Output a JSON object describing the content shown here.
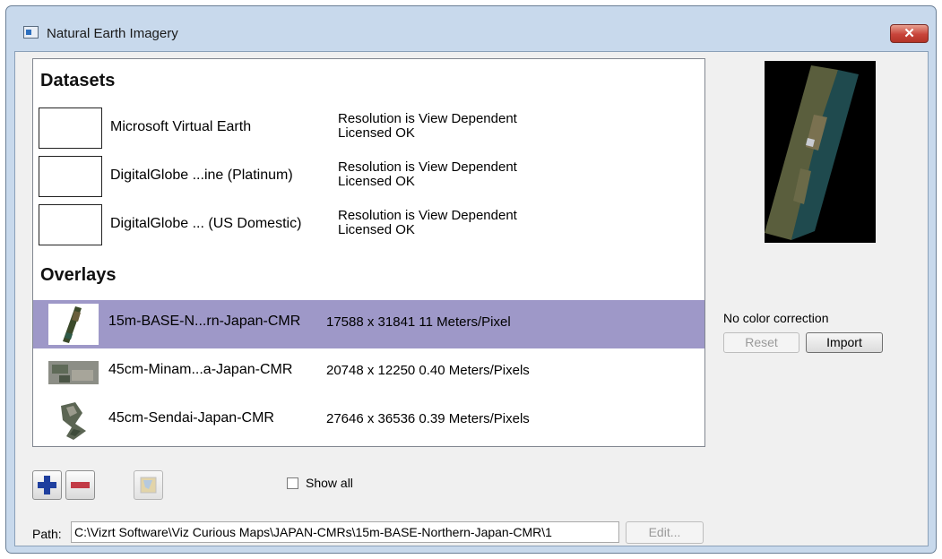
{
  "window": {
    "title": "Natural Earth Imagery",
    "close_label": "✕"
  },
  "datasets": {
    "heading": "Datasets",
    "items": [
      {
        "name": "Microsoft Virtual Earth",
        "info1": "Resolution is View Dependent",
        "info2": "Licensed OK"
      },
      {
        "name": "DigitalGlobe ...ine (Platinum)",
        "info1": "Resolution is View Dependent",
        "info2": "Licensed OK"
      },
      {
        "name": "DigitalGlobe ... (US Domestic)",
        "info1": "Resolution is View Dependent",
        "info2": "Licensed OK"
      }
    ]
  },
  "overlays": {
    "heading": "Overlays",
    "items": [
      {
        "name": "15m-BASE-N...rn-Japan-CMR",
        "info": "17588 x 31841 11 Meters/Pixel",
        "selected": true
      },
      {
        "name": "45cm-Minam...a-Japan-CMR",
        "info": "20748 x 12250  0.40 Meters/Pixels",
        "selected": false
      },
      {
        "name": "45cm-Sendai-Japan-CMR",
        "info": "27646 x 36536  0.39 Meters/Pixels",
        "selected": false
      }
    ]
  },
  "color_correction": {
    "label": "No color correction",
    "reset_label": "Reset",
    "import_label": "Import"
  },
  "toolbar": {
    "show_all_label": "Show all",
    "show_all_checked": false
  },
  "path": {
    "label": "Path:",
    "value": "C:\\Vizrt Software\\Viz Curious Maps\\JAPAN-CMRs\\15m-BASE-Northern-Japan-CMR\\1",
    "edit_label": "Edit..."
  },
  "colors": {
    "selection": "#9e98c8",
    "add": "#1f3f9e",
    "remove": "#c23a45"
  }
}
